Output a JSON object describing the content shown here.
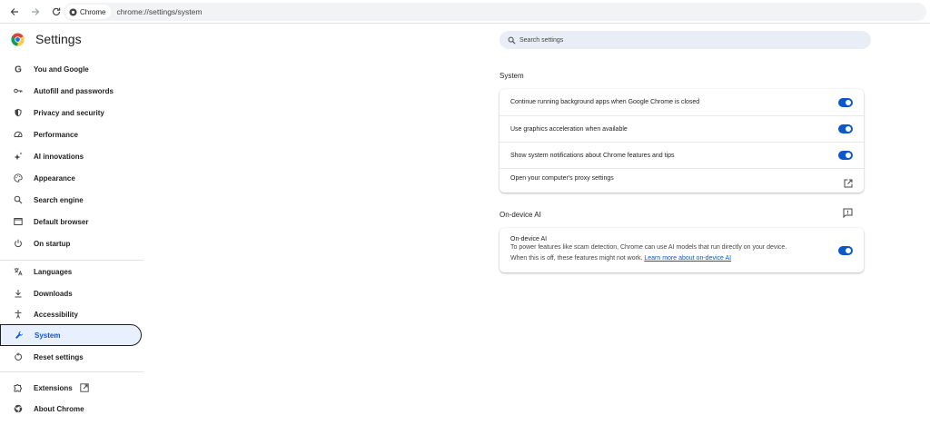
{
  "browser": {
    "chip_label": "Chrome",
    "url": "chrome://settings/system"
  },
  "header": {
    "title": "Settings"
  },
  "search": {
    "placeholder": "Search settings"
  },
  "sidebar": {
    "items": [
      {
        "label": "You and Google",
        "icon": "google-g-icon"
      },
      {
        "label": "Autofill and passwords",
        "icon": "key-icon"
      },
      {
        "label": "Privacy and security",
        "icon": "shield-icon"
      },
      {
        "label": "Performance",
        "icon": "speedometer-icon"
      },
      {
        "label": "AI innovations",
        "icon": "sparkle-icon"
      },
      {
        "label": "Appearance",
        "icon": "palette-icon"
      },
      {
        "label": "Search engine",
        "icon": "search-icon"
      },
      {
        "label": "Default browser",
        "icon": "browser-window-icon"
      },
      {
        "label": "On startup",
        "icon": "power-icon"
      },
      {
        "label": "Languages",
        "icon": "translate-icon"
      },
      {
        "label": "Downloads",
        "icon": "download-icon"
      },
      {
        "label": "Accessibility",
        "icon": "accessibility-icon"
      },
      {
        "label": "System",
        "icon": "wrench-icon",
        "active": true
      },
      {
        "label": "Reset settings",
        "icon": "reset-icon"
      },
      {
        "label": "Extensions",
        "icon": "puzzle-icon"
      },
      {
        "label": "About Chrome",
        "icon": "chrome-icon"
      }
    ]
  },
  "system": {
    "title": "System",
    "rows": [
      {
        "label": "Continue running background apps when Google Chrome is closed",
        "enabled": true
      },
      {
        "label": "Use graphics acceleration when available",
        "enabled": true
      },
      {
        "label": "Show system notifications about Chrome features and tips",
        "enabled": true
      },
      {
        "label": "Open your computer's proxy settings"
      }
    ]
  },
  "ondevice": {
    "title": "On-device AI",
    "row_title": "On-device AI",
    "desc_line1": "To power features like scam detection, Chrome can use AI models that run directly on your device.",
    "desc_line2": "When this is off, these features might not work.",
    "link": "Learn more about on-device AI",
    "enabled": true
  },
  "colors": {
    "accent": "#0b57d0",
    "active_bg": "#e8f0fe",
    "search_bg": "#e9eef6"
  }
}
